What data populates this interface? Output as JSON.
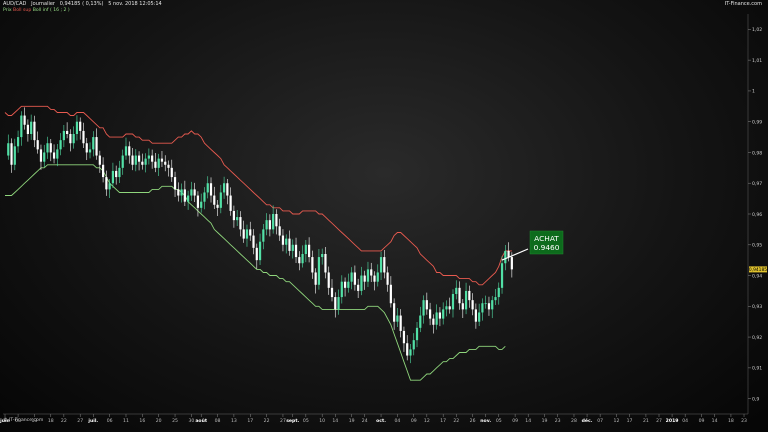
{
  "header": {
    "symbol": "AUD/CAD",
    "period": "Journalier",
    "price": "0,94185",
    "change": "( 0,13%)",
    "datetime": "5 nov. 2018 12:05:14",
    "legend": [
      {
        "text": "Prix",
        "color": "#9be08a"
      },
      {
        "text": "Boll sup",
        "color": "#e85a4f"
      },
      {
        "text": "Boll inf ( 16 ; 2 )",
        "color": "#9be08a"
      }
    ],
    "brand": "IT-Finance.com"
  },
  "footer": {
    "copyright": "© IT-Finance.com"
  },
  "annotation": {
    "label": "ACHAT",
    "value": "0.9460"
  },
  "last_price_tag": "0,94185",
  "chart_data": {
    "type": "candlestick",
    "title": "",
    "ylim": [
      0.895,
      1.025
    ],
    "y_ticks": [
      {
        "v": 1.02,
        "label": "1,02"
      },
      {
        "v": 1.01,
        "label": "1,01"
      },
      {
        "v": 1.0,
        "label": "1"
      },
      {
        "v": 0.99,
        "label": "0,99"
      },
      {
        "v": 0.98,
        "label": "0,98"
      },
      {
        "v": 0.97,
        "label": "0,97"
      },
      {
        "v": 0.96,
        "label": "0,96"
      },
      {
        "v": 0.95,
        "label": "0,95"
      },
      {
        "v": 0.94,
        "label": "0,94"
      },
      {
        "v": 0.93,
        "label": "0,93"
      },
      {
        "v": 0.92,
        "label": "0,92"
      },
      {
        "v": 0.91,
        "label": "0,91"
      },
      {
        "v": 0.9,
        "label": "0,9"
      }
    ],
    "x_ticks": [
      {
        "i": 0,
        "label": "juin",
        "month": true
      },
      {
        "i": 4,
        "label": "08"
      },
      {
        "i": 9,
        "label": "13"
      },
      {
        "i": 14,
        "label": "18"
      },
      {
        "i": 18,
        "label": "22"
      },
      {
        "i": 23,
        "label": "27"
      },
      {
        "i": 27,
        "label": "juil.",
        "month": true
      },
      {
        "i": 32,
        "label": "06"
      },
      {
        "i": 37,
        "label": "11"
      },
      {
        "i": 42,
        "label": "16"
      },
      {
        "i": 47,
        "label": "20"
      },
      {
        "i": 52,
        "label": "25"
      },
      {
        "i": 57,
        "label": "30"
      },
      {
        "i": 60,
        "label": "août",
        "month": true
      },
      {
        "i": 65,
        "label": "08"
      },
      {
        "i": 70,
        "label": "13"
      },
      {
        "i": 75,
        "label": "17"
      },
      {
        "i": 80,
        "label": "22"
      },
      {
        "i": 85,
        "label": "27"
      },
      {
        "i": 88,
        "label": "sept.",
        "month": true
      },
      {
        "i": 92,
        "label": "05"
      },
      {
        "i": 97,
        "label": "10"
      },
      {
        "i": 101,
        "label": "14"
      },
      {
        "i": 106,
        "label": "19"
      },
      {
        "i": 110,
        "label": "24"
      },
      {
        "i": 115,
        "label": "oct.",
        "month": true
      },
      {
        "i": 120,
        "label": "04"
      },
      {
        "i": 125,
        "label": "09"
      },
      {
        "i": 129,
        "label": "12"
      },
      {
        "i": 134,
        "label": "17"
      },
      {
        "i": 138,
        "label": "22"
      },
      {
        "i": 143,
        "label": "26"
      },
      {
        "i": 147,
        "label": "nov.",
        "month": true
      },
      {
        "i": 151,
        "label": "05"
      },
      {
        "i": 156,
        "label": "09"
      },
      {
        "i": 160,
        "label": "14"
      },
      {
        "i": 165,
        "label": "19"
      },
      {
        "i": 169,
        "label": "23"
      },
      {
        "i": 174,
        "label": "28"
      },
      {
        "i": 178,
        "label": "déc.",
        "month": true
      },
      {
        "i": 182,
        "label": "07"
      },
      {
        "i": 187,
        "label": "12"
      },
      {
        "i": 191,
        "label": "17"
      },
      {
        "i": 196,
        "label": "21"
      },
      {
        "i": 200,
        "label": "27"
      },
      {
        "i": 204,
        "label": "2019",
        "month": true
      },
      {
        "i": 208,
        "label": "04"
      },
      {
        "i": 213,
        "label": "09"
      },
      {
        "i": 217,
        "label": "14"
      },
      {
        "i": 222,
        "label": "18"
      },
      {
        "i": 226,
        "label": "23"
      }
    ],
    "close": [
      0.979,
      0.983,
      0.976,
      0.982,
      0.985,
      0.992,
      0.989,
      0.986,
      0.99,
      0.984,
      0.981,
      0.977,
      0.98,
      0.983,
      0.98,
      0.978,
      0.981,
      0.984,
      0.987,
      0.986,
      0.983,
      0.986,
      0.99,
      0.987,
      0.983,
      0.98,
      0.981,
      0.985,
      0.979,
      0.976,
      0.972,
      0.968,
      0.97,
      0.974,
      0.972,
      0.975,
      0.979,
      0.982,
      0.979,
      0.976,
      0.979,
      0.977,
      0.976,
      0.978,
      0.979,
      0.977,
      0.975,
      0.978,
      0.977,
      0.976,
      0.975,
      0.972,
      0.968,
      0.966,
      0.968,
      0.964,
      0.966,
      0.968,
      0.966,
      0.962,
      0.964,
      0.967,
      0.97,
      0.966,
      0.963,
      0.962,
      0.967,
      0.97,
      0.966,
      0.961,
      0.958,
      0.959,
      0.955,
      0.952,
      0.955,
      0.953,
      0.949,
      0.945,
      0.951,
      0.955,
      0.958,
      0.955,
      0.96,
      0.956,
      0.953,
      0.95,
      0.952,
      0.948,
      0.95,
      0.946,
      0.944,
      0.947,
      0.95,
      0.946,
      0.941,
      0.937,
      0.946,
      0.947,
      0.941,
      0.936,
      0.933,
      0.929,
      0.933,
      0.938,
      0.936,
      0.938,
      0.941,
      0.937,
      0.935,
      0.94,
      0.938,
      0.942,
      0.94,
      0.938,
      0.941,
      0.946,
      0.941,
      0.937,
      0.931,
      0.925,
      0.927,
      0.922,
      0.918,
      0.914,
      0.916,
      0.919,
      0.923,
      0.927,
      0.932,
      0.929,
      0.926,
      0.924,
      0.928,
      0.926,
      0.929,
      0.93,
      0.929,
      0.934,
      0.936,
      0.931,
      0.929,
      0.935,
      0.932,
      0.929,
      0.925,
      0.928,
      0.931,
      0.931,
      0.929,
      0.932,
      0.933,
      0.936,
      0.944,
      0.948,
      0.946,
      0.942
    ],
    "upper_band": [
      0.993,
      0.992,
      0.992,
      0.993,
      0.994,
      0.995,
      0.995,
      0.995,
      0.995,
      0.995,
      0.995,
      0.995,
      0.995,
      0.995,
      0.994,
      0.994,
      0.993,
      0.993,
      0.993,
      0.993,
      0.992,
      0.992,
      0.993,
      0.993,
      0.993,
      0.992,
      0.991,
      0.99,
      0.989,
      0.988,
      0.988,
      0.986,
      0.985,
      0.985,
      0.985,
      0.985,
      0.985,
      0.986,
      0.986,
      0.986,
      0.985,
      0.985,
      0.984,
      0.984,
      0.984,
      0.983,
      0.983,
      0.983,
      0.983,
      0.983,
      0.983,
      0.983,
      0.984,
      0.985,
      0.985,
      0.986,
      0.986,
      0.987,
      0.986,
      0.986,
      0.985,
      0.983,
      0.982,
      0.981,
      0.98,
      0.979,
      0.978,
      0.976,
      0.975,
      0.974,
      0.973,
      0.972,
      0.971,
      0.97,
      0.969,
      0.968,
      0.967,
      0.966,
      0.965,
      0.964,
      0.963,
      0.963,
      0.962,
      0.962,
      0.962,
      0.961,
      0.961,
      0.961,
      0.96,
      0.96,
      0.96,
      0.961,
      0.961,
      0.961,
      0.961,
      0.961,
      0.96,
      0.96,
      0.959,
      0.958,
      0.957,
      0.956,
      0.955,
      0.954,
      0.953,
      0.952,
      0.951,
      0.95,
      0.949,
      0.948,
      0.948,
      0.948,
      0.948,
      0.948,
      0.948,
      0.948,
      0.949,
      0.95,
      0.951,
      0.953,
      0.954,
      0.954,
      0.953,
      0.952,
      0.951,
      0.95,
      0.949,
      0.947,
      0.946,
      0.945,
      0.944,
      0.943,
      0.941,
      0.941,
      0.94,
      0.94,
      0.94,
      0.94,
      0.94,
      0.939,
      0.939,
      0.939,
      0.939,
      0.938,
      0.938,
      0.937,
      0.937,
      0.938,
      0.939,
      0.94,
      0.941,
      0.943,
      0.946,
      0.948,
      0.948,
      0.948
    ],
    "lower_band": [
      0.966,
      0.966,
      0.966,
      0.967,
      0.968,
      0.969,
      0.97,
      0.971,
      0.972,
      0.973,
      0.974,
      0.975,
      0.975,
      0.976,
      0.976,
      0.976,
      0.976,
      0.976,
      0.976,
      0.976,
      0.976,
      0.976,
      0.976,
      0.976,
      0.976,
      0.976,
      0.976,
      0.976,
      0.975,
      0.975,
      0.974,
      0.972,
      0.97,
      0.969,
      0.968,
      0.967,
      0.967,
      0.967,
      0.967,
      0.967,
      0.967,
      0.967,
      0.967,
      0.967,
      0.967,
      0.968,
      0.968,
      0.968,
      0.969,
      0.969,
      0.969,
      0.969,
      0.968,
      0.968,
      0.967,
      0.966,
      0.964,
      0.963,
      0.962,
      0.961,
      0.96,
      0.959,
      0.958,
      0.957,
      0.955,
      0.954,
      0.953,
      0.952,
      0.951,
      0.95,
      0.949,
      0.948,
      0.947,
      0.946,
      0.945,
      0.944,
      0.943,
      0.942,
      0.942,
      0.941,
      0.941,
      0.94,
      0.94,
      0.94,
      0.939,
      0.939,
      0.938,
      0.938,
      0.937,
      0.936,
      0.935,
      0.934,
      0.933,
      0.932,
      0.931,
      0.93,
      0.93,
      0.929,
      0.929,
      0.929,
      0.929,
      0.929,
      0.929,
      0.929,
      0.929,
      0.929,
      0.929,
      0.929,
      0.929,
      0.929,
      0.929,
      0.93,
      0.93,
      0.93,
      0.93,
      0.929,
      0.928,
      0.926,
      0.924,
      0.921,
      0.918,
      0.915,
      0.912,
      0.909,
      0.906,
      0.906,
      0.906,
      0.906,
      0.907,
      0.908,
      0.908,
      0.909,
      0.91,
      0.911,
      0.912,
      0.912,
      0.913,
      0.913,
      0.914,
      0.915,
      0.915,
      0.915,
      0.916,
      0.916,
      0.916,
      0.917,
      0.917,
      0.917,
      0.917,
      0.917,
      0.917,
      0.916,
      0.916,
      0.917
    ]
  }
}
